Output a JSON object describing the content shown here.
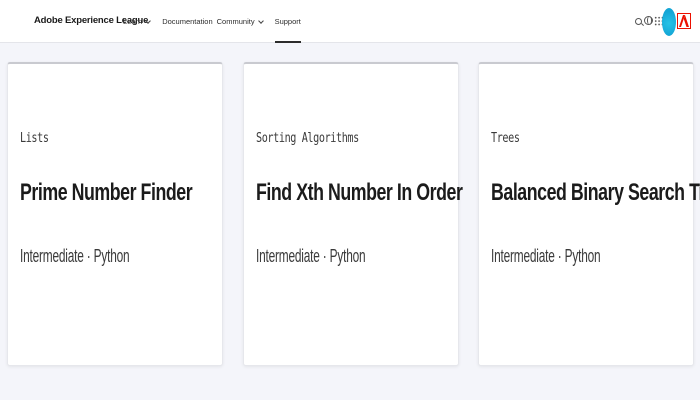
{
  "header": {
    "brand": "Adobe Experience League",
    "nav": [
      {
        "label": "Learn",
        "has_dropdown": true,
        "active": false
      },
      {
        "label": "Documentation",
        "has_dropdown": false,
        "active": false
      },
      {
        "label": "Community",
        "has_dropdown": true,
        "active": false
      },
      {
        "label": "Support",
        "has_dropdown": false,
        "active": true
      }
    ],
    "icons": [
      "search-icon",
      "globe-icon",
      "apps-grid-icon",
      "avatar",
      "adobe-logo"
    ]
  },
  "cards": [
    {
      "category": "Lists",
      "title": "Prime Number Finder",
      "meta": "Intermediate · Python"
    },
    {
      "category": "Sorting Algorithms",
      "title": "Find Xth Number In Order",
      "meta": "Intermediate · Python"
    },
    {
      "category": "Trees",
      "title": "Balanced Binary Search Tree",
      "meta": "Intermediate · Python"
    }
  ],
  "colors": {
    "page_background": "#f4f5fa",
    "card_background": "#ffffff",
    "avatar": "#14a6d6",
    "adobe_red": "#eb1000"
  }
}
